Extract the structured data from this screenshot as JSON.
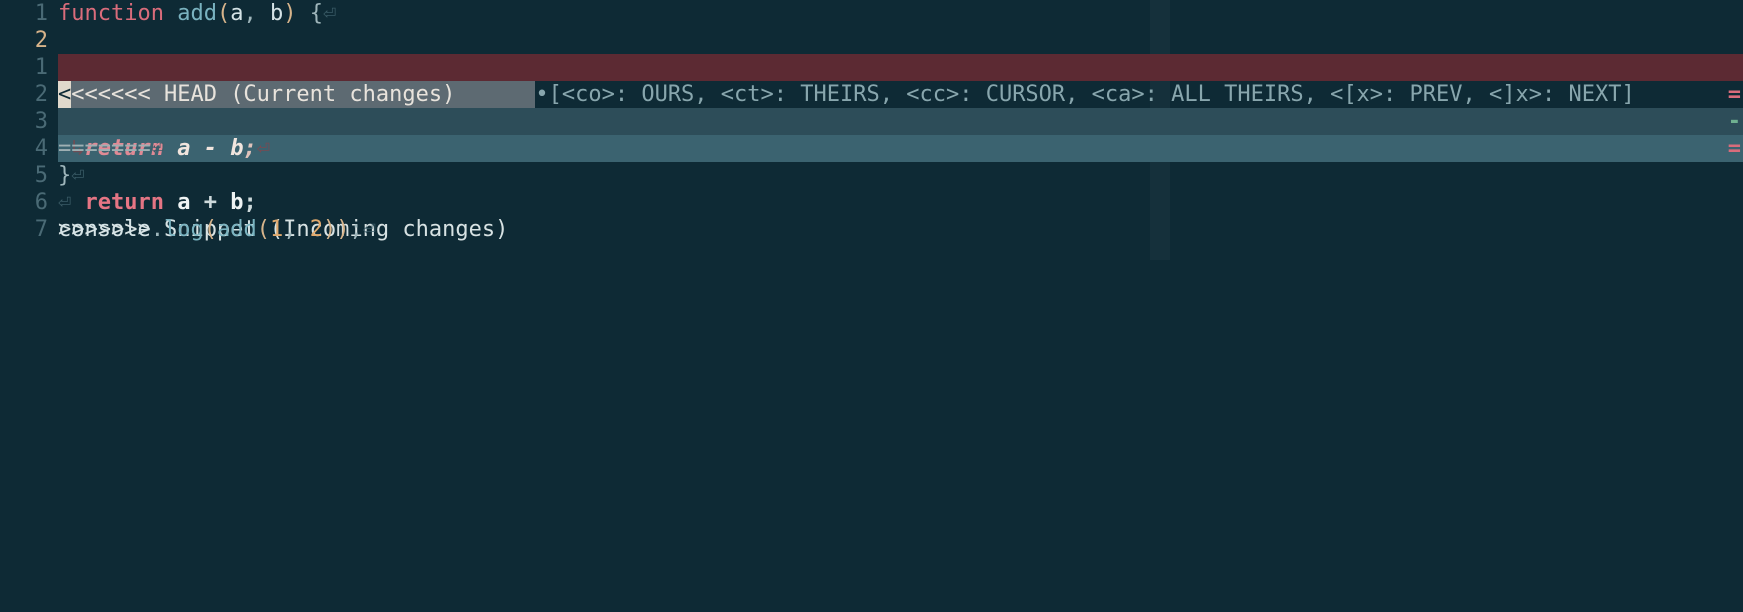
{
  "lines": {
    "l1": {
      "num": "1",
      "kw": "function",
      "fn": "add",
      "lp": "(",
      "a": "a",
      "comma": ", ",
      "b": "b",
      "rp": ")",
      "sp": " ",
      "brace": "{",
      "eol": "⏎"
    },
    "l2": {
      "num": "2",
      "cursor_char": "<",
      "marker": "<<<<<< HEAD (Current changes)",
      "bullet": "•",
      "hint": "[<co>: OURS, <ct>: THEIRS, <cc>: CURSOR, <ca>: ALL THEIRS, <[x>: PREV, <]x>: NEXT]"
    },
    "o1": {
      "num": "1",
      "ind": "↳",
      "kw": "return",
      "sp": " ",
      "a": "a",
      "op": " - ",
      "b": "b",
      "semi": ";",
      "eol": "⏎"
    },
    "s2": {
      "num": "2",
      "text": "=======",
      "eol": "⏎",
      "edge": "="
    },
    "t3": {
      "num": "3",
      "pad": "  ",
      "kw": "return",
      "sp": " ",
      "a": "a",
      "op": " + ",
      "b": "b",
      "semi": ";",
      "edge": "-"
    },
    "t4": {
      "num": "4",
      "text": ">>>>>>> Snippet (Incoming changes)",
      "edge": "="
    },
    "l5": {
      "num": "5",
      "brace": "}",
      "eol": "⏎"
    },
    "l6": {
      "num": "6",
      "eol": "⏎"
    },
    "l7": {
      "num": "7",
      "obj": "console",
      "dot": ".",
      "meth": "log",
      "lp": "(",
      "fn": "add",
      "lp2": "(",
      "n1": "1",
      "comma": ", ",
      "n2": "2",
      "rp2": ")",
      "rp": ")",
      "semi": ";",
      "eol": "⏎"
    }
  }
}
